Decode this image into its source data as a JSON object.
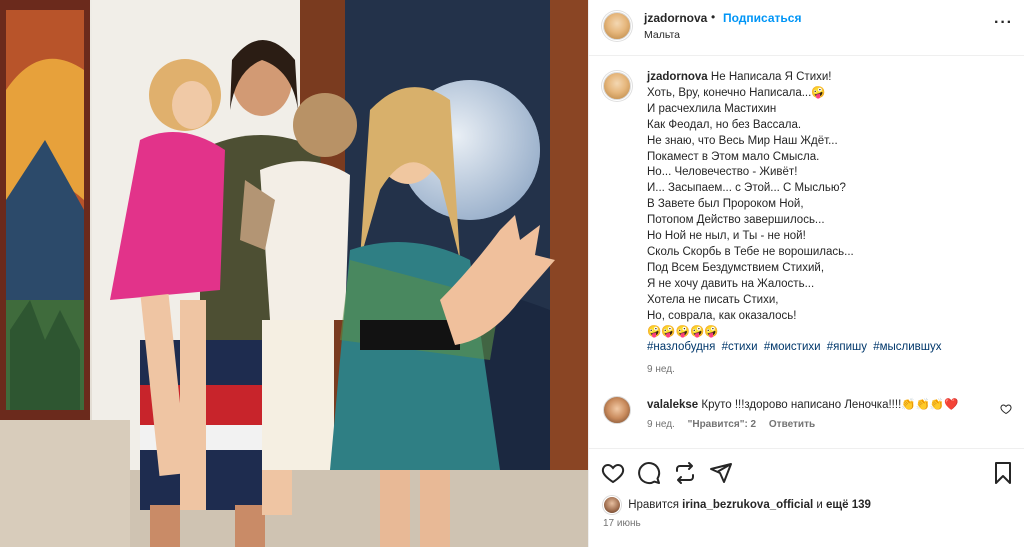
{
  "post": {
    "username": "jzadornova",
    "follow_label": "Подписаться",
    "location": "Мальта",
    "more_icon": "more-horizontal-icon"
  },
  "caption": {
    "username": "jzadornova",
    "lines": [
      "Не Написала Я Стихи!",
      "Хоть, Вру, конечно Написала...🤪",
      "И расчехлила Мастихин",
      "Как Феодал, но без Вассала.",
      "Не знаю, что Весь Мир Наш Ждёт...",
      "Покамест в Этом мало Смысла.",
      "Но... Человечество - Живёт!",
      "И... Засыпаем... с Этой... С Мыслью?",
      "В Завете был Пророком Ной,",
      "Потопом Действо завершилось...",
      "Но Ной не ныл, и Ты - не ной!",
      "Сколь Скорбь в Тебе не ворошилась...",
      "Под Всем Бездумствием Стихий,",
      "Я не хочу давить на Жалость...",
      "Хотела не писать Стихи,",
      "Но, соврала, как оказалось!",
      "🤪🤪🤪🤪🤪"
    ],
    "hashtags": [
      "#назлобудня",
      "#стихи",
      "#моистихи",
      "#япишу",
      "#мыслившух"
    ],
    "time": "9 нед."
  },
  "comment": {
    "username": "valalekse",
    "text": "Круто !!!здорово написано Леночка!!!!👏👏👏❤️",
    "time": "9 нед.",
    "likes_label": "\"Нравится\": 2",
    "reply_label": "Ответить"
  },
  "actions": {
    "icons": [
      "heart-icon",
      "comment-icon",
      "repost-icon",
      "share-icon",
      "bookmark-icon"
    ]
  },
  "likes": {
    "prefix": "Нравится",
    "user": "irina_bezrukova_official",
    "mid": "и",
    "others": "ещё 139"
  },
  "date": "17 июнь"
}
